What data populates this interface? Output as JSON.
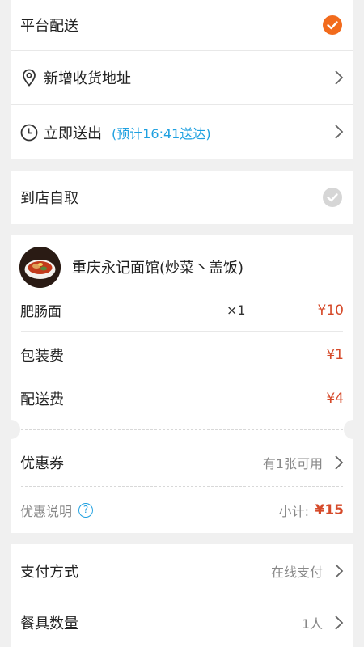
{
  "delivery": {
    "platform_label": "平台配送",
    "add_address_label": "新增收货地址",
    "deliver_now_label": "立即送出",
    "eta_text": "(预计16:41送达)"
  },
  "pickup": {
    "label": "到店自取"
  },
  "order": {
    "shop_name": "重庆永记面馆(炒菜丶盖饭)",
    "items": [
      {
        "name": "肥肠面",
        "qty": "×1",
        "price": "¥10"
      }
    ],
    "packaging_label": "包装费",
    "packaging_price": "¥1",
    "delivery_fee_label": "配送费",
    "delivery_fee_price": "¥4",
    "coupon_label": "优惠券",
    "coupon_value": "有1张可用",
    "discount_info_label": "优惠说明",
    "subtotal_label": "小计:",
    "subtotal_value": "¥15"
  },
  "payment": {
    "method_label": "支付方式",
    "method_value": "在线支付",
    "utensils_label": "餐具数量",
    "utensils_value": "1人"
  },
  "colors": {
    "accent": "#f26b1d",
    "eta": "#1ea0e0",
    "price": "#d64a2a",
    "unchecked": "#d6d6d6"
  }
}
